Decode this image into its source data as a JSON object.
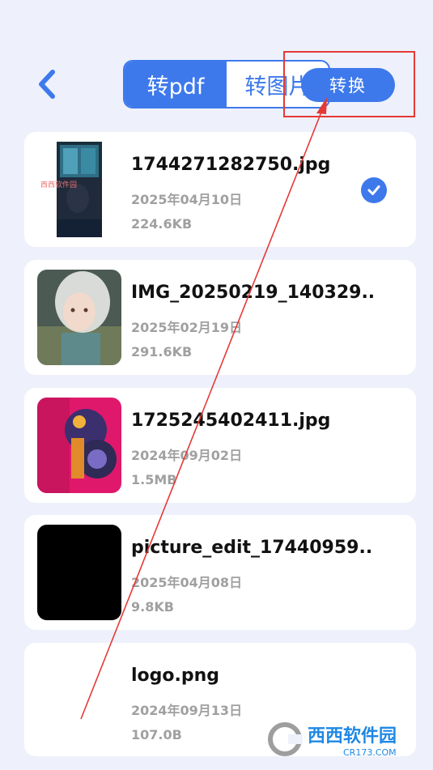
{
  "header": {
    "tabs": [
      {
        "label": "转pdf",
        "active": true
      },
      {
        "label": "转图片",
        "active": false
      }
    ],
    "convert_label": "转换"
  },
  "files": [
    {
      "name": "1744271282750.jpg",
      "date": "2025年04月10日",
      "size": "224.6KB",
      "selected": true,
      "thumb_overlay_text": "西西软件园"
    },
    {
      "name": "IMG_20250219_140329...",
      "date": "2025年02月19日",
      "size": "291.6KB",
      "selected": false
    },
    {
      "name": "1725245402411.jpg",
      "date": "2024年09月02日",
      "size": "1.5MB",
      "selected": false
    },
    {
      "name": "picture_edit_17440959...",
      "date": "2025年04月08日",
      "size": "9.8KB",
      "selected": false
    },
    {
      "name": "logo.png",
      "date": "2024年09月13日",
      "size": "107.0B",
      "selected": false
    }
  ],
  "watermark": {
    "text": "西西软件园",
    "sub": "CR173.COM"
  },
  "colors": {
    "accent": "#3e79ec",
    "annotation": "#e53935",
    "background": "#eef1fc"
  }
}
